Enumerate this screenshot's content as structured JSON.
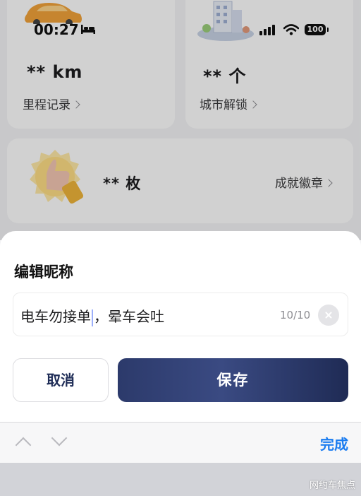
{
  "status_bar": {
    "time": "00:27",
    "battery": "100"
  },
  "stats": {
    "mileage": {
      "value": "** km",
      "link": "里程记录"
    },
    "city": {
      "value": "** 个",
      "link": "城市解锁"
    },
    "badge": {
      "value": "** 枚",
      "link": "成就徽章"
    }
  },
  "dialog": {
    "title": "编辑昵称",
    "input_before_caret": "电车勿接单",
    "input_after_caret": "，晕车会吐",
    "char_count": "10/10",
    "cancel_label": "取消",
    "save_label": "保存"
  },
  "keyboard_bar": {
    "done_label": "完成"
  },
  "watermark": "网约车焦点",
  "colors": {
    "accent_blue": "#1a7cf0",
    "save_button": "#2c3a6b",
    "cancel_text": "#1f2d57"
  }
}
